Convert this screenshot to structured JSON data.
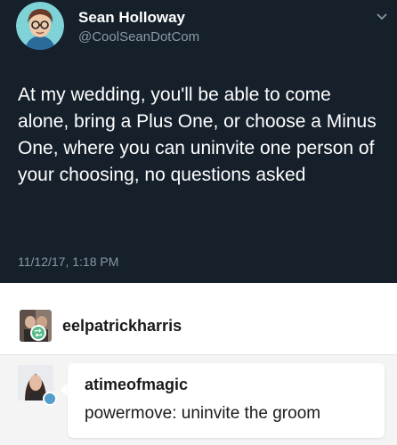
{
  "tweet": {
    "author": {
      "display_name": "Sean Holloway",
      "handle": "@CoolSeanDotCom"
    },
    "text": "At my wedding, you'll be able to come alone, bring a Plus One, or choose a Minus One, where you can uninvite one person of your choosing, no questions asked",
    "timestamp": "11/12/17, 1:18 PM"
  },
  "reblog": {
    "reblogger": "eelpatrickharris",
    "comment": {
      "author": "atimeofmagic",
      "text": "powermove: uninvite the groom"
    }
  },
  "colors": {
    "tweet_background": "#15202b",
    "tweet_secondary_text": "#8899a6",
    "reblog_badge": "#56bc8a",
    "comment_badge": "#529ecc"
  }
}
